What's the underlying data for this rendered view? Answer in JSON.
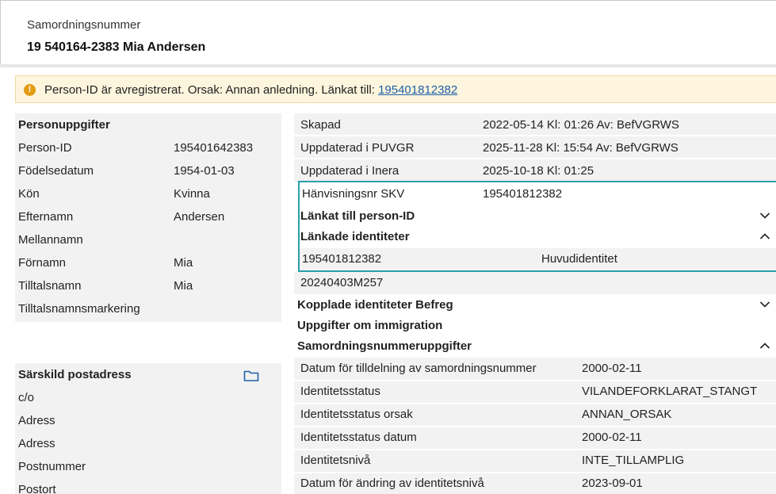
{
  "header": {
    "label": "Samordningsnummer",
    "title": "19 540164-2383 Mia Andersen"
  },
  "alert": {
    "icon": "warning-icon",
    "message": "Person-ID är avregistrerat. Orsak: Annan anledning. Länkat till: ",
    "link": "195401812382",
    "color": "#fdf5dd"
  },
  "personal": {
    "heading": "Personuppgifter",
    "rows": [
      {
        "label": "Person-ID",
        "value": "195401642383"
      },
      {
        "label": "Födelsedatum",
        "value": "1954-01-03"
      },
      {
        "label": "Kön",
        "value": "Kvinna"
      },
      {
        "label": "Efternamn",
        "value": "Andersen"
      },
      {
        "label": "Mellannamn",
        "value": ""
      },
      {
        "label": "Förnamn",
        "value": "Mia"
      },
      {
        "label": "Tilltalsnamn",
        "value": "Mia"
      },
      {
        "label": "Tilltalsnamnsmarkering",
        "value": ""
      }
    ]
  },
  "postal": {
    "heading": "Särskild postadress",
    "icon": "folder-icon",
    "rows": [
      "c/o",
      "Adress",
      "Adress",
      "Postnummer",
      "Postort"
    ]
  },
  "meta": {
    "rows": [
      {
        "label": "Skapad",
        "value": "2022-05-14 Kl: 01:26 Av: BefVGRWS"
      },
      {
        "label": "Uppdaterad i PUVGR",
        "value": "2025-11-28 Kl: 15:54 Av: BefVGRWS"
      },
      {
        "label": "Uppdaterad i Inera",
        "value": "2025-10-18 Kl: 01:25"
      }
    ]
  },
  "links": {
    "ref_label": "Hänvisningsnr SKV",
    "ref_value": "195401812382",
    "linked_to": "Länkat till person-ID",
    "linked_ids": "Länkade identiteter",
    "linked_row_id": "195401812382",
    "linked_row_type": "Huvudidentitet",
    "extra_id": "20240403M257",
    "accent": "#2a9fab"
  },
  "sections": {
    "befreg": "Kopplade identiteter Befreg",
    "immigration": "Uppgifter om immigration",
    "samordning": "Samordningsnummeruppgifter"
  },
  "samordning_rows": [
    {
      "label": "Datum för tilldelning av samordningsnummer",
      "value": "2000-02-11"
    },
    {
      "label": "Identitetsstatus",
      "value": "VILANDEFORKLARAT_STANGT"
    },
    {
      "label": "Identitetsstatus orsak",
      "value": "ANNAN_ORSAK"
    },
    {
      "label": "Identitetsstatus datum",
      "value": "2000-02-11"
    },
    {
      "label": "Identitetsnivå",
      "value": "INTE_TILLAMPLIG"
    },
    {
      "label": "Datum för ändring av identitetsnivå",
      "value": "2023-09-01"
    }
  ]
}
